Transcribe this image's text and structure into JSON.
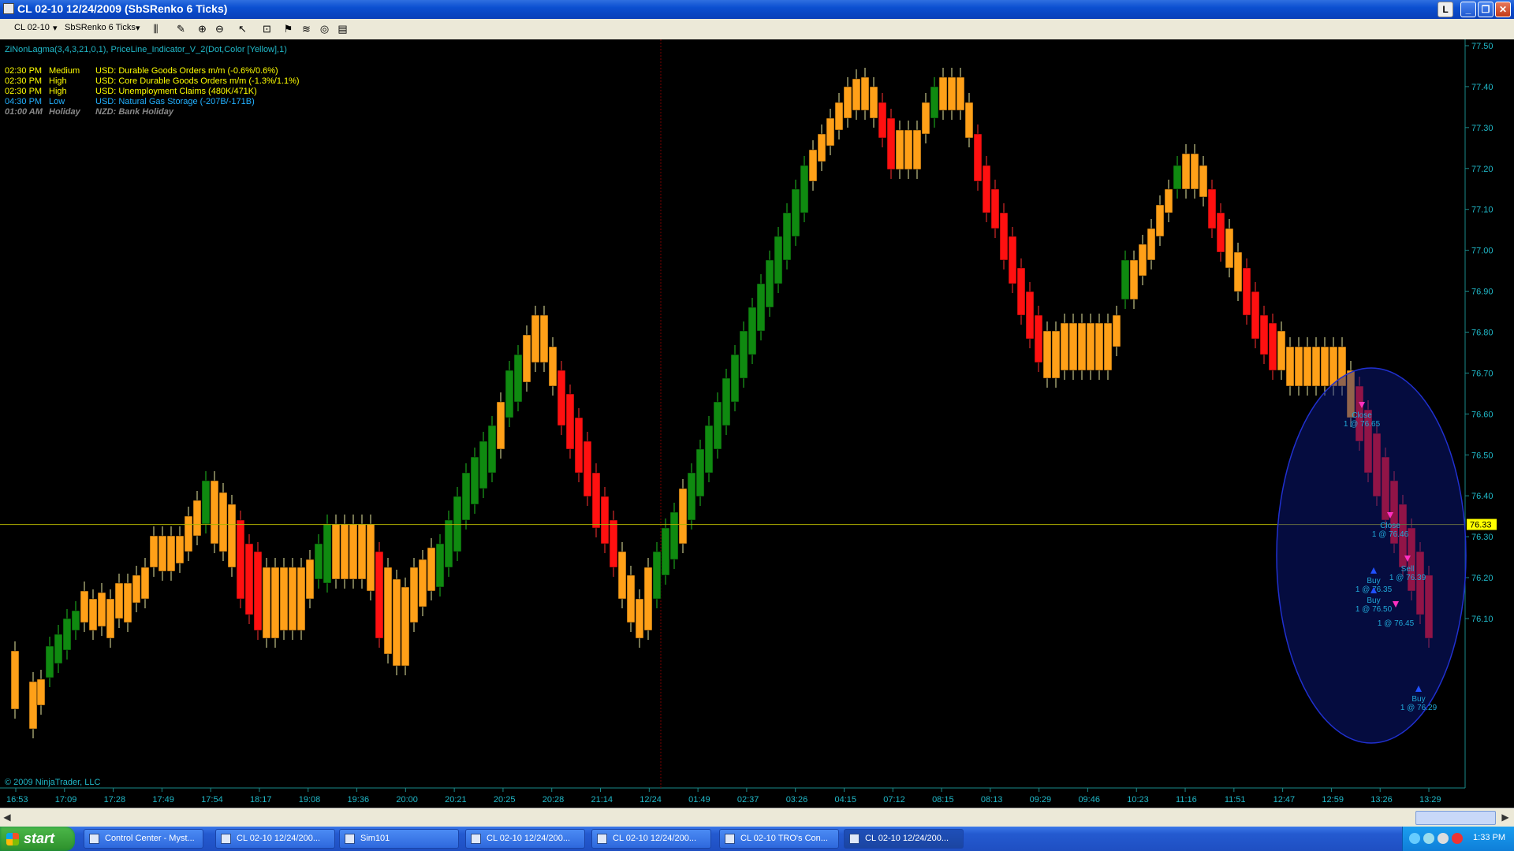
{
  "window": {
    "title": "CL 02-10  12/24/2009 (SbSRenko 6 Ticks)",
    "btn_l": "L"
  },
  "toolbar": {
    "instrument": "CL 02-10",
    "period": "SbSRenko 6 Ticks"
  },
  "chart": {
    "indicator_label": "ZiNonLagma(3,4,3,21,0,1), PriceLine_Indicator_V_2(Dot,Color [Yellow],1)",
    "copyright": "© 2009 NinjaTrader, LLC",
    "news": [
      {
        "time": "02:30 PM",
        "level": "Medium",
        "text": "USD: Durable Goods Orders m/m (-0.6%/0.6%)",
        "color": "#ffff00"
      },
      {
        "time": "02:30 PM",
        "level": "High",
        "text": "USD: Core Durable Goods Orders m/m (-1.3%/1.1%)",
        "color": "#ffff00"
      },
      {
        "time": "02:30 PM",
        "level": "High",
        "text": "USD: Unemployment Claims (480K/471K)",
        "color": "#ffff00"
      },
      {
        "time": "04:30 PM",
        "level": "Low",
        "text": "USD: Natural Gas Storage (-207B/-171B)",
        "color": "#22b0ff"
      },
      {
        "time": "01:00 AM",
        "level": "Holiday",
        "text": "NZD: Bank Holiday",
        "color": "#888888"
      }
    ],
    "current_price": "76.33",
    "price_labels": [
      "77.50",
      "77.40",
      "77.30",
      "77.20",
      "77.10",
      "77.00",
      "76.90",
      "76.80",
      "76.70",
      "76.60",
      "76.50",
      "76.40",
      "76.30",
      "76.20",
      "76.10"
    ],
    "time_labels": [
      "16:53",
      "17:09",
      "17:28",
      "17:49",
      "17:54",
      "18:17",
      "19:08",
      "19:36",
      "20:00",
      "20:21",
      "20:25",
      "20:28",
      "21:14",
      "12/24",
      "01:49",
      "02:37",
      "03:26",
      "04:15",
      "07:12",
      "08:15",
      "08:13",
      "09:29",
      "09:46",
      "10:23",
      "11:16",
      "11:51",
      "12:47",
      "12:59",
      "13:26",
      "13:29"
    ],
    "trades": [
      {
        "side": "Close",
        "qty": "1 @ 76.65"
      },
      {
        "side": "Close",
        "qty": "1 @ 76.46"
      },
      {
        "side": "Sell",
        "qty": "1 @ 76.39"
      },
      {
        "side": "Buy",
        "qty": "1 @ 76.35"
      },
      {
        "side": "Buy",
        "qty": "1 @ 76.50"
      },
      {
        "side": "",
        "qty": "1 @ 76.45"
      },
      {
        "side": "Buy",
        "qty": "1 @ 76.29"
      }
    ]
  },
  "taskbar": {
    "start": "start",
    "tasks": [
      "Control Center - Myst...",
      "CL 02-10  12/24/200...",
      "Sim101",
      "CL 02-10  12/24/200...",
      "CL 02-10  12/24/200...",
      "CL 02-10  TRO's Con...",
      "CL 02-10  12/24/200..."
    ],
    "clock": "1:33 PM"
  }
}
